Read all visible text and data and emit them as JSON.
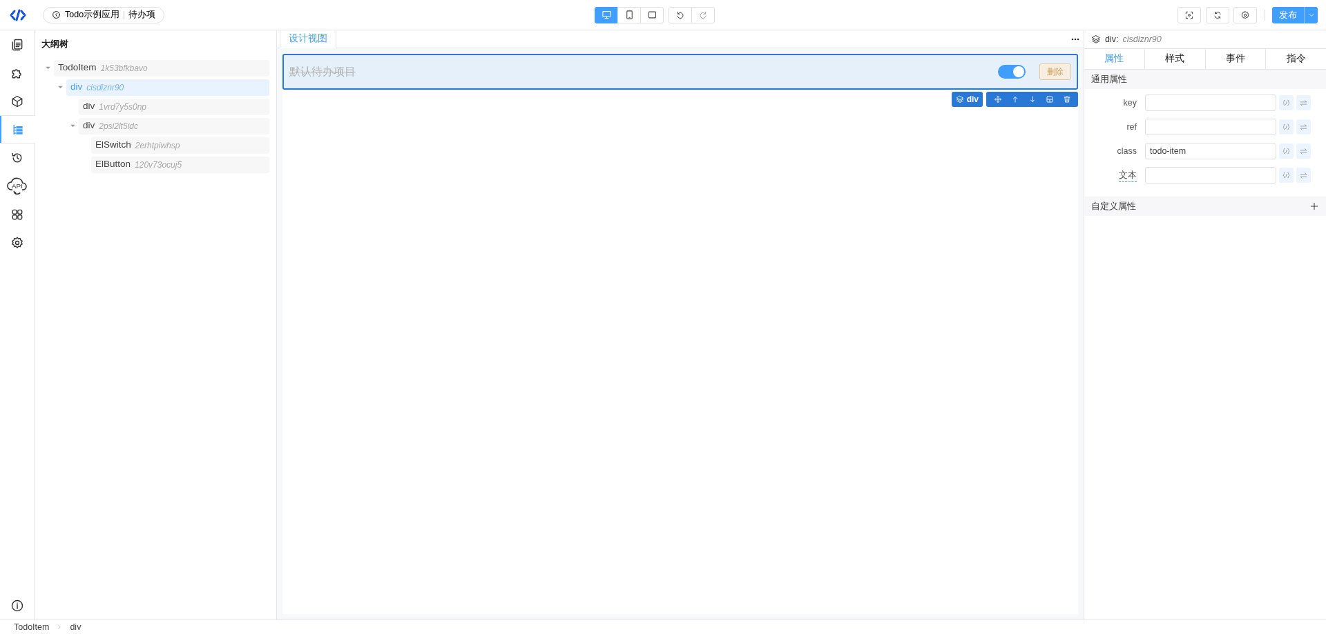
{
  "topbar": {
    "app": "Todo示例应用",
    "page": "待办项",
    "devices": [
      {
        "kind": "desktop",
        "selected": true
      },
      {
        "kind": "tablet",
        "selected": false
      },
      {
        "kind": "frame",
        "selected": false
      }
    ],
    "history": [
      {
        "kind": "undo",
        "disabled": false
      },
      {
        "kind": "redo",
        "disabled": true
      }
    ],
    "tools": [
      {
        "kind": "preview"
      },
      {
        "kind": "refresh"
      },
      {
        "kind": "settings"
      }
    ],
    "publish": "发布"
  },
  "sidebar": {
    "items": [
      {
        "kind": "pages",
        "selected": false
      },
      {
        "kind": "plugin",
        "selected": false
      },
      {
        "kind": "box",
        "selected": false
      },
      {
        "kind": "outline",
        "selected": true
      },
      {
        "kind": "history",
        "selected": false
      },
      {
        "kind": "api",
        "label": "API",
        "selected": false
      },
      {
        "kind": "apps",
        "selected": false
      },
      {
        "kind": "settings",
        "selected": false
      }
    ],
    "bottom": [
      {
        "kind": "info"
      }
    ]
  },
  "outline": {
    "title": "大纲树",
    "tree": [
      {
        "name": "TodoItem",
        "id": "1k53bfkbavo",
        "expanded": true,
        "selected": false,
        "children": [
          {
            "name": "div",
            "id": "cisdiznr90",
            "expanded": true,
            "selected": true,
            "children": [
              {
                "name": "div",
                "id": "1vrd7y5s0np",
                "selected": false
              },
              {
                "name": "div",
                "id": "2psi2lt5idc",
                "expanded": true,
                "selected": false,
                "children": [
                  {
                    "name": "ElSwitch",
                    "id": "2erhtpiwhsp",
                    "selected": false
                  },
                  {
                    "name": "ElButton",
                    "id": "120v73ocuj5",
                    "selected": false
                  }
                ]
              }
            ]
          }
        ]
      }
    ]
  },
  "canvas": {
    "tabs": [
      {
        "label": "设计视图",
        "selected": true
      }
    ],
    "todo": {
      "text": "默认待办项目",
      "completed": true,
      "switch_on": true,
      "delete_label": "删除"
    },
    "selection": {
      "label": "div",
      "actions": [
        {
          "kind": "move"
        },
        {
          "kind": "up"
        },
        {
          "kind": "down"
        },
        {
          "kind": "copy"
        },
        {
          "kind": "delete"
        }
      ]
    }
  },
  "inspector": {
    "tag": "div:",
    "id": "cisdiznr90",
    "tabs": [
      {
        "label": "属性",
        "selected": true
      },
      {
        "label": "样式",
        "selected": false
      },
      {
        "label": "事件",
        "selected": false
      },
      {
        "label": "指令",
        "selected": false
      }
    ],
    "section": "通用属性",
    "fields": [
      {
        "label": "key",
        "underlined": false
      },
      {
        "label": "ref",
        "underlined": false
      },
      {
        "label": "class",
        "value": "todo-item",
        "underlined": false
      },
      {
        "label": "文本",
        "underlined": true
      }
    ],
    "custom_section": "自定义属性"
  },
  "breadcrumb": [
    "TodoItem",
    "div"
  ]
}
